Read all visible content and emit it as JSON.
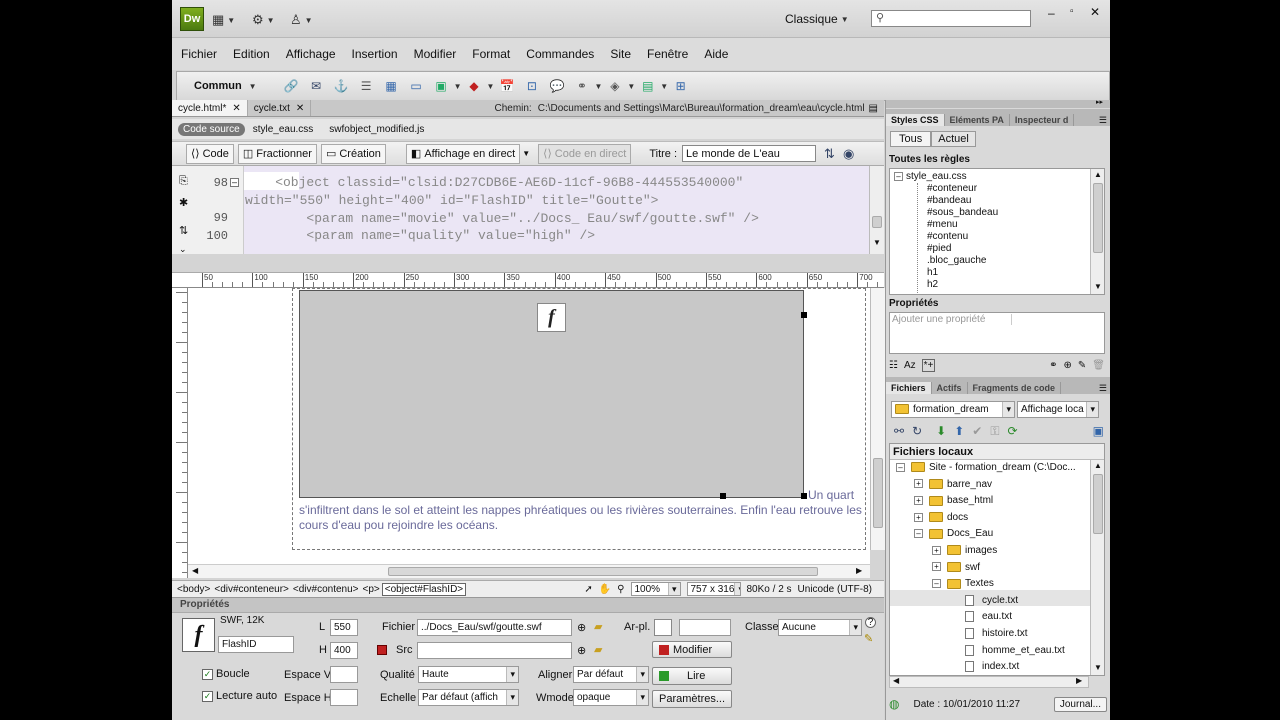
{
  "titlebar": {
    "logo": "Dw",
    "workspace": "Classique",
    "search_placeholder": ""
  },
  "menu": [
    "Fichier",
    "Edition",
    "Affichage",
    "Insertion",
    "Modifier",
    "Format",
    "Commandes",
    "Site",
    "Fenêtre",
    "Aide"
  ],
  "insertbar": {
    "category": "Commun"
  },
  "doc_tabs": [
    {
      "label": "cycle.html*",
      "active": true
    },
    {
      "label": "cycle.txt",
      "active": false
    }
  ],
  "path": {
    "label": "Chemin:",
    "value": "C:\\Documents and Settings\\Marc\\Bureau\\formation_dream\\eau\\cycle.html"
  },
  "related_files": {
    "badge": "Code source",
    "files": [
      "style_eau.css",
      "swfobject_modified.js"
    ]
  },
  "doc_toolbar": {
    "code": "Code",
    "split": "Fractionner",
    "design": "Création",
    "live": "Affichage en direct",
    "livecode": "Code en direct",
    "title_label": "Titre :",
    "title_value": "Le monde de L'eau"
  },
  "code": {
    "lines": [
      {
        "num": "98",
        "text": "    <object classid=\"clsid:D27CDB6E-AE6D-11cf-96B8-444553540000\""
      },
      {
        "num": "",
        "text": "width=\"550\" height=\"400\" id=\"FlashID\" title=\"Goutte\">"
      },
      {
        "num": "99",
        "text": "        <param name=\"movie\" value=\"../Docs_ Eau/swf/goutte.swf\" />"
      },
      {
        "num": "100",
        "text": "        <param name=\"quality\" value=\"high\" />"
      }
    ]
  },
  "ruler": [
    "50",
    "100",
    "150",
    "200",
    "250",
    "300",
    "350",
    "400",
    "450",
    "500",
    "550",
    "600",
    "650",
    "700",
    "750"
  ],
  "design_text": {
    "inline": "Un quart",
    "paragraph": "s'infiltrent dans le sol et atteint les nappes phréatiques ou les rivières souterraines. Enfin l'eau retrouve les cours d'eau pou rejoindre les océans."
  },
  "tag_selector": {
    "tags": [
      "<body>",
      "<div#conteneur>",
      "<div#contenu>",
      "<p>",
      "<object#FlashID>"
    ],
    "zoom": "100%",
    "size": "757 x 316",
    "download": "80Ko / 2 s",
    "encoding": "Unicode (UTF-8)"
  },
  "properties": {
    "title": "Propriétés",
    "type": "SWF, 12K",
    "id": "FlashID",
    "L_label": "L",
    "L": "550",
    "H_label": "H",
    "H": "400",
    "fichier_label": "Fichier",
    "fichier": "../Docs_Eau/swf/goutte.swf",
    "src_label": "Src",
    "src": "",
    "arpl_label": "Ar-pl.",
    "arpl": "",
    "classe_label": "Classe",
    "classe": "Aucune",
    "modifier": "Modifier",
    "boucle": "Boucle",
    "lecture_auto": "Lecture auto",
    "espace_v": "Espace V",
    "espace_h": "Espace H",
    "qualite_label": "Qualité",
    "qualite": "Haute",
    "echelle_label": "Echelle",
    "echelle": "Par défaut (affich",
    "aligner_label": "Aligner",
    "aligner": "Par défaut",
    "wmode_label": "Wmode",
    "wmode": "opaque",
    "lire": "Lire",
    "parametres": "Paramètres..."
  },
  "css_panel": {
    "tabs": [
      "Styles CSS",
      "Eléments PA",
      "Inspecteur d"
    ],
    "toggle": [
      "Tous",
      "Actuel"
    ],
    "rules_title": "Toutes les règles",
    "rules": [
      "style_eau.css",
      "#conteneur",
      "#bandeau",
      "#sous_bandeau",
      "#menu",
      "#contenu",
      "#pied",
      ".bloc_gauche",
      "h1",
      "h2"
    ],
    "props_title": "Propriétés",
    "add_prop": "Ajouter une propriété"
  },
  "files_panel": {
    "tabs": [
      "Fichiers",
      "Actifs",
      "Fragments de code"
    ],
    "site": "formation_dream",
    "view": "Affichage loca",
    "header": "Fichiers locaux",
    "tree": [
      {
        "label": "Site - formation_dream (C:\\Doc...",
        "level": 0,
        "type": "site",
        "pm": "-"
      },
      {
        "label": "barre_nav",
        "level": 1,
        "type": "folder",
        "pm": "+"
      },
      {
        "label": "base_html",
        "level": 1,
        "type": "folder",
        "pm": "+"
      },
      {
        "label": "docs",
        "level": 1,
        "type": "folder",
        "pm": "+"
      },
      {
        "label": "Docs_Eau",
        "level": 1,
        "type": "folder",
        "pm": "-"
      },
      {
        "label": "images",
        "level": 2,
        "type": "folder",
        "pm": "+"
      },
      {
        "label": "swf",
        "level": 2,
        "type": "folder",
        "pm": "+"
      },
      {
        "label": "Textes",
        "level": 2,
        "type": "folder",
        "pm": "-"
      },
      {
        "label": "cycle.txt",
        "level": 3,
        "type": "file",
        "pm": ""
      },
      {
        "label": "eau.txt",
        "level": 3,
        "type": "file",
        "pm": ""
      },
      {
        "label": "histoire.txt",
        "level": 3,
        "type": "file",
        "pm": ""
      },
      {
        "label": "homme_et_eau.txt",
        "level": 3,
        "type": "file",
        "pm": ""
      },
      {
        "label": "index.txt",
        "level": 3,
        "type": "file",
        "pm": ""
      }
    ],
    "status": "Date : 10/01/2010 11:27",
    "journal": "Journal..."
  },
  "colors": {
    "accent": "#4b7a10",
    "flash_red": "#c02020",
    "selection": "#e4e4e4"
  }
}
